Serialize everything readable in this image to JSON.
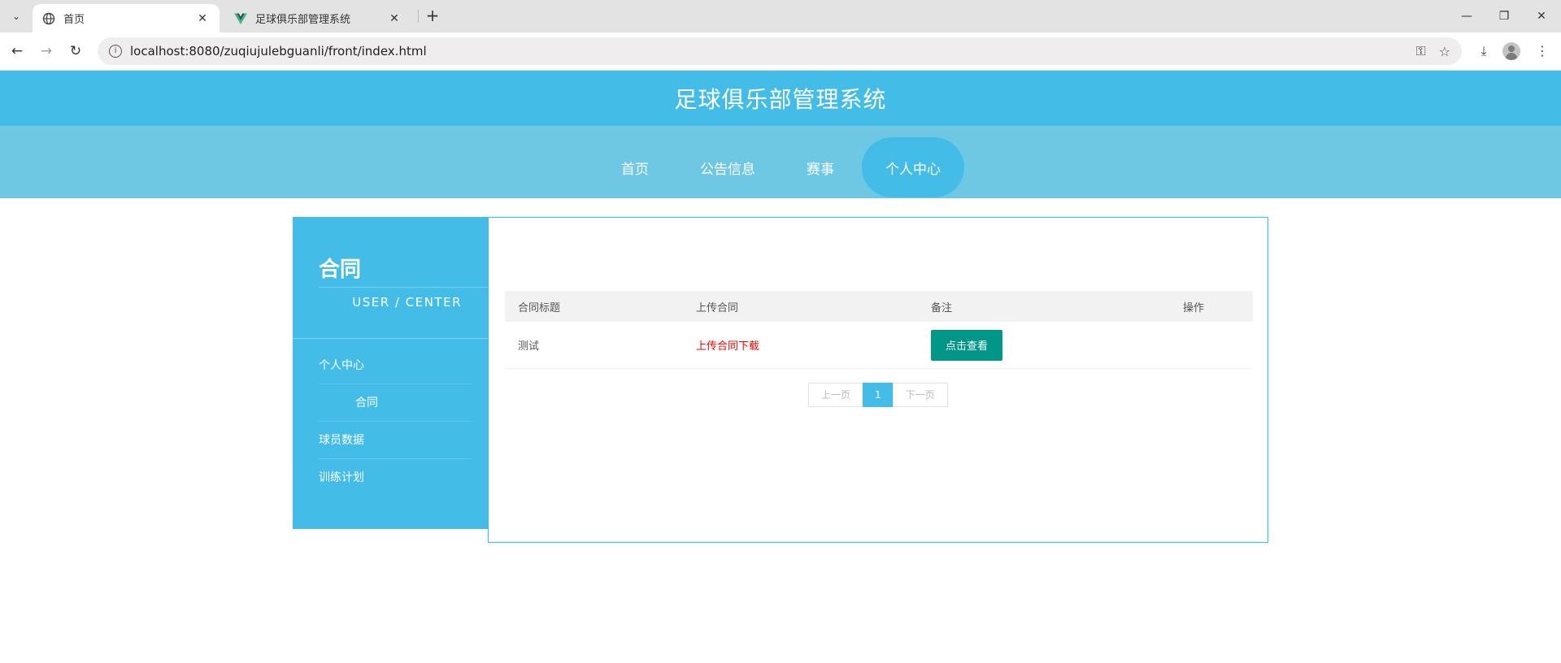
{
  "browser": {
    "tabs": [
      {
        "title": "首页",
        "active": true
      },
      {
        "title": "足球俱乐部管理系统",
        "active": false
      }
    ],
    "url": "localhost:8080/zuqiujulebguanli/front/index.html"
  },
  "site": {
    "title": "足球俱乐部管理系统",
    "nav": [
      "首页",
      "公告信息",
      "赛事",
      "个人中心"
    ],
    "active_nav": "个人中心"
  },
  "sidebar": {
    "title": "合同",
    "subtitle": "USER / CENTER",
    "items": [
      {
        "label": "个人中心"
      },
      {
        "label": "合同"
      },
      {
        "label": "球员数据"
      },
      {
        "label": "训练计划"
      }
    ]
  },
  "table": {
    "headers": [
      "合同标题",
      "上传合同",
      "备注",
      "操作"
    ],
    "rows": [
      {
        "title": "测试",
        "download": "上传合同下载",
        "action": "点击查看"
      }
    ]
  },
  "pager": {
    "prev": "上一页",
    "current": "1",
    "next": "下一页"
  },
  "colors": {
    "header": "#43bce8",
    "navbar": "#6ec8e4",
    "button": "#009688",
    "link": "#ff0000"
  }
}
